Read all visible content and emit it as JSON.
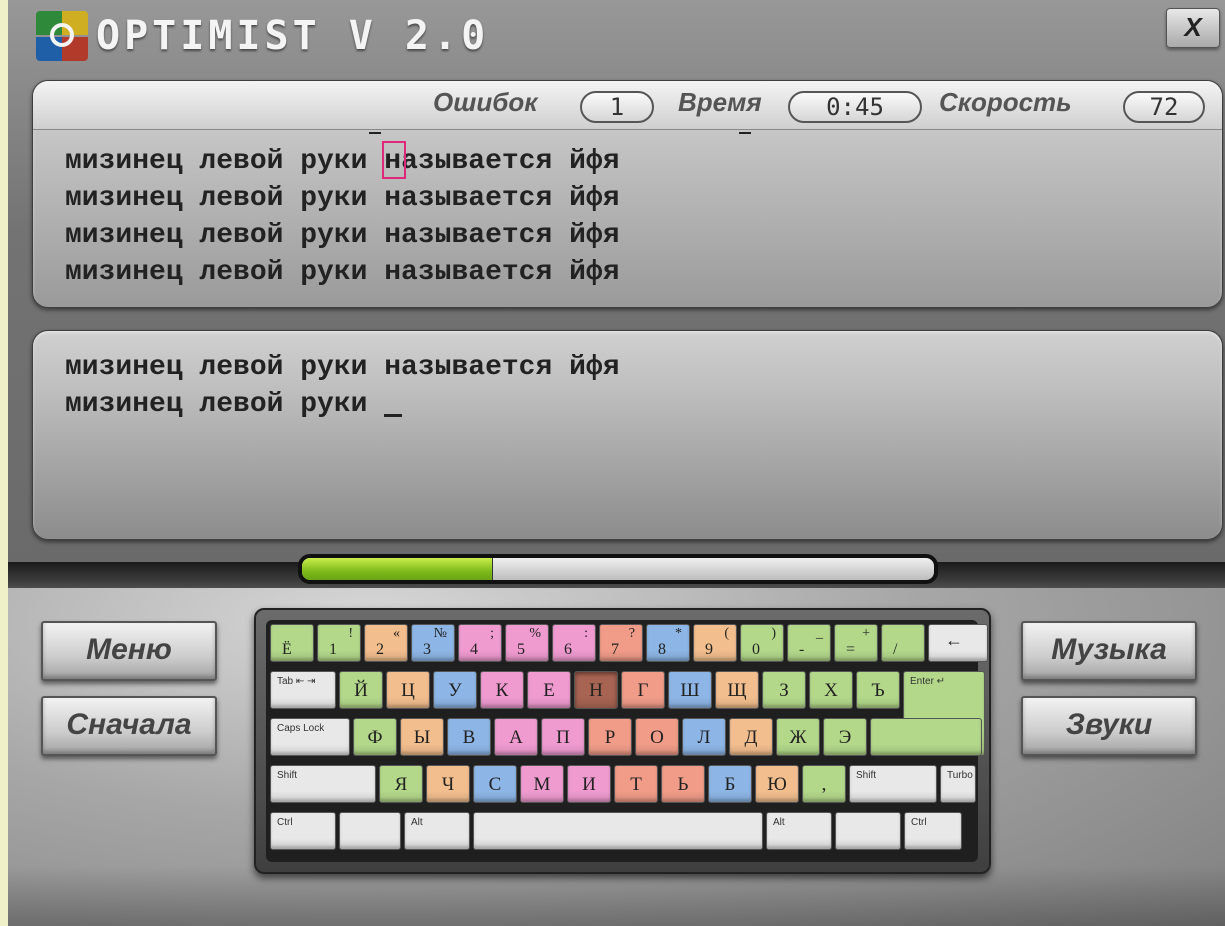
{
  "app": {
    "logo_text": "OPTIMIST V 2.0",
    "close_label": "X"
  },
  "stats": {
    "errors_label": "Ошибок",
    "errors_value": "1",
    "time_label": "Время",
    "time_value": "0:45",
    "speed_label": "Скорость",
    "speed_value": "72"
  },
  "exercise": {
    "lines": [
      "мизинец левой руки называется йфя",
      "мизинец левой руки называется йфя",
      "мизинец левой руки называется йфя",
      "мизинец левой руки называется йфя"
    ],
    "highlight_prefix": "мизинец левой руки ",
    "highlight_char": "н",
    "highlight_suffix": "азывается йфя"
  },
  "typed": {
    "lines": [
      "мизинец левой руки называется йфя",
      "мизинец левой руки "
    ]
  },
  "progress": {
    "value": 0.3
  },
  "buttons": {
    "menu": "Меню",
    "restart": "Сначала",
    "music": "Музыка",
    "sounds": "Звуки"
  },
  "colors": {
    "green": "#b3d88a",
    "orange": "#f2be8e",
    "blue": "#8db6e6",
    "pink": "#ef9bd0",
    "red": "#f09c88",
    "active": "#a86452",
    "gray": "#e8e8e8"
  },
  "keyboard": {
    "rows": [
      [
        {
          "b": "Ё",
          "c": "green",
          "w": 44
        },
        {
          "t": "!",
          "b": "1",
          "c": "green",
          "w": 44
        },
        {
          "t": "«",
          "b": "2",
          "c": "orange",
          "w": 44
        },
        {
          "t": "№",
          "b": "3",
          "c": "blue",
          "w": 44
        },
        {
          "t": ";",
          "b": "4",
          "c": "pink",
          "w": 44
        },
        {
          "t": "%",
          "b": "5",
          "c": "pink",
          "w": 44
        },
        {
          "t": ":",
          "b": "6",
          "c": "pink",
          "w": 44
        },
        {
          "t": "?",
          "b": "7",
          "c": "red",
          "w": 44
        },
        {
          "t": "*",
          "b": "8",
          "c": "blue",
          "w": 44
        },
        {
          "t": "(",
          "b": "9",
          "c": "orange",
          "w": 44
        },
        {
          "t": ")",
          "b": "0",
          "c": "green",
          "w": 44
        },
        {
          "t": "_",
          "b": "-",
          "c": "green",
          "w": 44
        },
        {
          "t": "+",
          "b": "=",
          "c": "green",
          "w": 44
        },
        {
          "t": "",
          "b": "/",
          "c": "green",
          "w": 44
        },
        {
          "ar": "←",
          "c": "gray",
          "w": 60
        }
      ],
      [
        {
          "s": "Tab ⇤ ⇥",
          "c": "gray",
          "w": 66
        },
        {
          "m": "Й",
          "c": "green",
          "w": 44
        },
        {
          "m": "Ц",
          "c": "orange",
          "w": 44
        },
        {
          "m": "У",
          "c": "blue",
          "w": 44
        },
        {
          "m": "К",
          "c": "pink",
          "w": 44
        },
        {
          "m": "Е",
          "c": "pink",
          "w": 44
        },
        {
          "m": "Н",
          "c": "active",
          "w": 44
        },
        {
          "m": "Г",
          "c": "red",
          "w": 44
        },
        {
          "m": "Ш",
          "c": "blue",
          "w": 44
        },
        {
          "m": "Щ",
          "c": "orange",
          "w": 44
        },
        {
          "m": "З",
          "c": "green",
          "w": 44
        },
        {
          "m": "Х",
          "c": "green",
          "w": 44
        },
        {
          "m": "Ъ",
          "c": "green",
          "w": 44
        },
        {
          "s": "Enter ↵",
          "c": "green",
          "w": 82
        }
      ],
      [
        {
          "s": "Caps Lock",
          "c": "gray",
          "w": 80
        },
        {
          "m": "Ф",
          "c": "green",
          "w": 44
        },
        {
          "m": "Ы",
          "c": "orange",
          "w": 44
        },
        {
          "m": "В",
          "c": "blue",
          "w": 44
        },
        {
          "m": "А",
          "c": "pink",
          "w": 44
        },
        {
          "m": "П",
          "c": "pink",
          "w": 44
        },
        {
          "m": "Р",
          "c": "red",
          "w": 44
        },
        {
          "m": "О",
          "c": "red",
          "w": 44
        },
        {
          "m": "Л",
          "c": "blue",
          "w": 44
        },
        {
          "m": "Д",
          "c": "orange",
          "w": 44
        },
        {
          "m": "Ж",
          "c": "green",
          "w": 44
        },
        {
          "m": "Э",
          "c": "green",
          "w": 44
        },
        {
          "s": "",
          "c": "green",
          "w": 112
        }
      ],
      [
        {
          "s": "Shift",
          "c": "gray",
          "w": 106
        },
        {
          "m": "Я",
          "c": "green",
          "w": 44
        },
        {
          "m": "Ч",
          "c": "orange",
          "w": 44
        },
        {
          "m": "С",
          "c": "blue",
          "w": 44
        },
        {
          "m": "М",
          "c": "pink",
          "w": 44
        },
        {
          "m": "И",
          "c": "pink",
          "w": 44
        },
        {
          "m": "Т",
          "c": "red",
          "w": 44
        },
        {
          "m": "Ь",
          "c": "red",
          "w": 44
        },
        {
          "m": "Б",
          "c": "blue",
          "w": 44
        },
        {
          "m": "Ю",
          "c": "orange",
          "w": 44
        },
        {
          "m": ",",
          "c": "green",
          "w": 44
        },
        {
          "s": "Shift",
          "c": "gray",
          "w": 88
        },
        {
          "s": "Turbo",
          "c": "gray",
          "w": 36
        }
      ],
      [
        {
          "s": "Ctrl",
          "c": "gray",
          "w": 66
        },
        {
          "s": "",
          "c": "gray",
          "w": 62
        },
        {
          "s": "Alt",
          "c": "gray",
          "w": 66
        },
        {
          "s": "",
          "c": "gray",
          "w": 290
        },
        {
          "s": "Alt",
          "c": "gray",
          "w": 66
        },
        {
          "s": "",
          "c": "gray",
          "w": 66
        },
        {
          "s": "Ctrl",
          "c": "gray",
          "w": 58
        }
      ]
    ]
  }
}
